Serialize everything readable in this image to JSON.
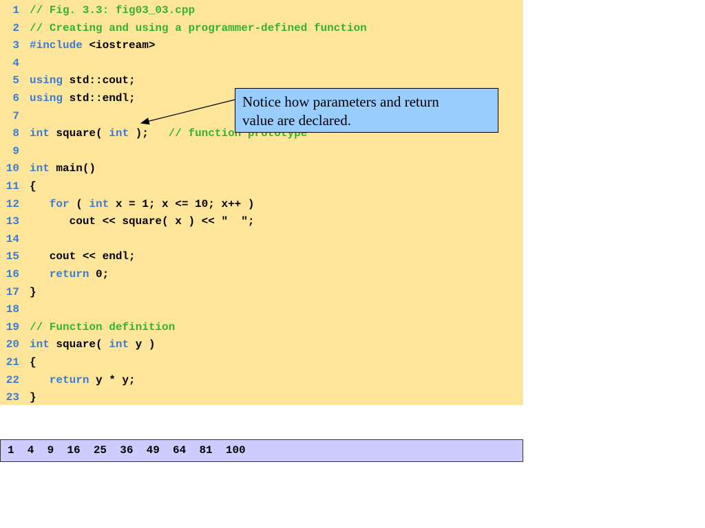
{
  "code": {
    "lines": [
      {
        "n": "1",
        "tokens": [
          {
            "t": "comment",
            "s": "// Fig. 3.3: fig03_03.cpp"
          }
        ]
      },
      {
        "n": "2",
        "tokens": [
          {
            "t": "comment",
            "s": "// Creating and using a programmer-defined function"
          }
        ]
      },
      {
        "n": "3",
        "tokens": [
          {
            "t": "keyword",
            "s": "#include"
          },
          {
            "t": "plain",
            "s": " <iostream>"
          }
        ]
      },
      {
        "n": "4",
        "tokens": []
      },
      {
        "n": "5",
        "tokens": [
          {
            "t": "keyword",
            "s": "using"
          },
          {
            "t": "plain",
            "s": " std::cout;"
          }
        ]
      },
      {
        "n": "6",
        "tokens": [
          {
            "t": "keyword",
            "s": "using"
          },
          {
            "t": "plain",
            "s": " std::endl;"
          }
        ]
      },
      {
        "n": "7",
        "tokens": []
      },
      {
        "n": "8",
        "tokens": [
          {
            "t": "keyword",
            "s": "int"
          },
          {
            "t": "plain",
            "s": " square( "
          },
          {
            "t": "keyword",
            "s": "int"
          },
          {
            "t": "plain",
            "s": " );   "
          },
          {
            "t": "comment",
            "s": "// function prototype"
          }
        ]
      },
      {
        "n": "9",
        "tokens": []
      },
      {
        "n": "10",
        "tokens": [
          {
            "t": "keyword",
            "s": "int"
          },
          {
            "t": "plain",
            "s": " main()"
          }
        ]
      },
      {
        "n": "11",
        "tokens": [
          {
            "t": "plain",
            "s": "{"
          }
        ]
      },
      {
        "n": "12",
        "tokens": [
          {
            "t": "keyword",
            "s": "   for"
          },
          {
            "t": "plain",
            "s": " ( "
          },
          {
            "t": "keyword",
            "s": "int"
          },
          {
            "t": "plain",
            "s": " x = 1; x <= 10; x++ )"
          }
        ]
      },
      {
        "n": "13",
        "tokens": [
          {
            "t": "plain",
            "s": "      cout << square( x ) << \"  \";"
          }
        ]
      },
      {
        "n": "14",
        "tokens": []
      },
      {
        "n": "15",
        "tokens": [
          {
            "t": "plain",
            "s": "   cout << endl;"
          }
        ]
      },
      {
        "n": "16",
        "tokens": [
          {
            "t": "keyword",
            "s": "   return"
          },
          {
            "t": "plain",
            "s": " 0;"
          }
        ]
      },
      {
        "n": "17",
        "tokens": [
          {
            "t": "plain",
            "s": "}"
          }
        ]
      },
      {
        "n": "18",
        "tokens": []
      },
      {
        "n": "19",
        "tokens": [
          {
            "t": "comment",
            "s": "// Function definition"
          }
        ]
      },
      {
        "n": "20",
        "tokens": [
          {
            "t": "keyword",
            "s": "int"
          },
          {
            "t": "plain",
            "s": " square( "
          },
          {
            "t": "keyword",
            "s": "int"
          },
          {
            "t": "plain",
            "s": " y )"
          }
        ]
      },
      {
        "n": "21",
        "tokens": [
          {
            "t": "plain",
            "s": "{"
          }
        ]
      },
      {
        "n": "22",
        "tokens": [
          {
            "t": "keyword",
            "s": "   return"
          },
          {
            "t": "plain",
            "s": " y * y;"
          }
        ]
      },
      {
        "n": "23",
        "tokens": [
          {
            "t": "plain",
            "s": "}"
          }
        ]
      }
    ]
  },
  "callout": {
    "text_line1": "Notice how parameters and return",
    "text_line2": "value are declared."
  },
  "output": {
    "text": "1  4  9  16  25  36  49  64  81  100"
  },
  "colors": {
    "code_background": "#ffe59a",
    "line_number": "#3a7bd5",
    "keyword": "#3a7bd5",
    "comment": "#33b233",
    "callout_background": "#99ccff",
    "output_background": "#ccccff"
  }
}
